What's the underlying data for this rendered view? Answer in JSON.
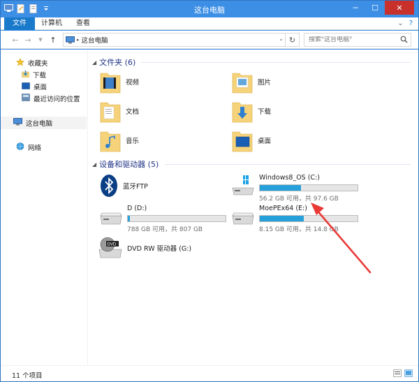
{
  "window": {
    "title": "这台电脑"
  },
  "ribbon": {
    "tabs": [
      {
        "label": "文件"
      },
      {
        "label": "计算机"
      },
      {
        "label": "查看"
      }
    ],
    "help": "?"
  },
  "address": {
    "crumbs": [
      "这台电脑"
    ],
    "search_placeholder": "搜索\"这台电脑\""
  },
  "sidebar": {
    "favorites": "收藏夹",
    "fav_items": [
      "下载",
      "桌面",
      "最近访问的位置"
    ],
    "this_pc": "这台电脑",
    "network": "网络"
  },
  "folders": {
    "header": "文件夹 (6)",
    "items": [
      "视频",
      "图片",
      "文档",
      "下载",
      "音乐",
      "桌面"
    ]
  },
  "devices": {
    "header": "设备和驱动器 (5)",
    "bluetooth": "蓝牙FTP",
    "drives": [
      {
        "name": "Windows8_OS (C:)",
        "free": "56.2 GB 可用，共 97.6 GB",
        "used_fraction": 0.424
      },
      {
        "name": "D (D:)",
        "free": "788 GB 可用，共 807 GB",
        "used_fraction": 0.024
      },
      {
        "name": "MoePEx64 (E:)",
        "free": "8.15 GB 可用，共 14.8 GB",
        "used_fraction": 0.449
      }
    ],
    "dvd": "DVD RW 驱动器 (G:)"
  },
  "status": {
    "count": "11 个项目"
  },
  "colors": {
    "titlebar": "#3d8fe6",
    "file_tab": "#1979ca",
    "header_text": "#1e3287",
    "bar_fill": "#26a0da",
    "annotation_arrow": "#e83a36"
  }
}
